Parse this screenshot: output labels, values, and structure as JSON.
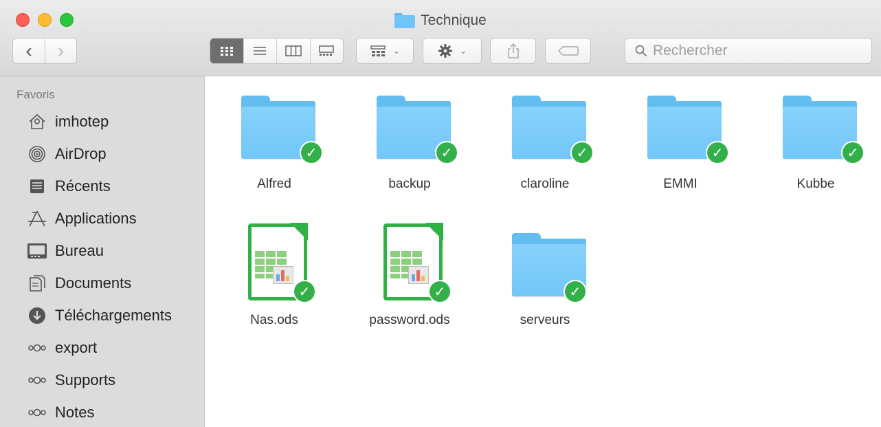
{
  "window": {
    "title": "Technique"
  },
  "toolbar": {
    "back_icon": "‹",
    "forward_icon": "›",
    "search_placeholder": "Rechercher",
    "arrange_chevron": "⌄",
    "action_chevron": "⌄"
  },
  "sidebar": {
    "heading": "Favoris",
    "items": [
      {
        "label": "imhotep",
        "icon": "home-icon"
      },
      {
        "label": "AirDrop",
        "icon": "airdrop-icon"
      },
      {
        "label": "Récents",
        "icon": "recents-icon"
      },
      {
        "label": "Applications",
        "icon": "applications-icon"
      },
      {
        "label": "Bureau",
        "icon": "desktop-icon"
      },
      {
        "label": "Documents",
        "icon": "documents-icon"
      },
      {
        "label": "Téléchargements",
        "icon": "downloads-icon"
      },
      {
        "label": "export",
        "icon": "link-icon"
      },
      {
        "label": "Supports",
        "icon": "link-icon"
      },
      {
        "label": "Notes",
        "icon": "link-icon"
      }
    ]
  },
  "files": [
    {
      "name": "Alfred",
      "kind": "folder"
    },
    {
      "name": "backup",
      "kind": "folder"
    },
    {
      "name": "claroline",
      "kind": "folder"
    },
    {
      "name": "EMMI",
      "kind": "folder"
    },
    {
      "name": "Kubbe",
      "kind": "folder"
    },
    {
      "name": "Nas.ods",
      "kind": "spreadsheet"
    },
    {
      "name": "password.ods",
      "kind": "spreadsheet"
    },
    {
      "name": "serveurs",
      "kind": "folder"
    }
  ],
  "colors": {
    "sync_badge": "#34b04a",
    "folder": "#73c7f8",
    "ods_frame": "#2fb146",
    "sidebar_bg": "#dcdcdc"
  }
}
